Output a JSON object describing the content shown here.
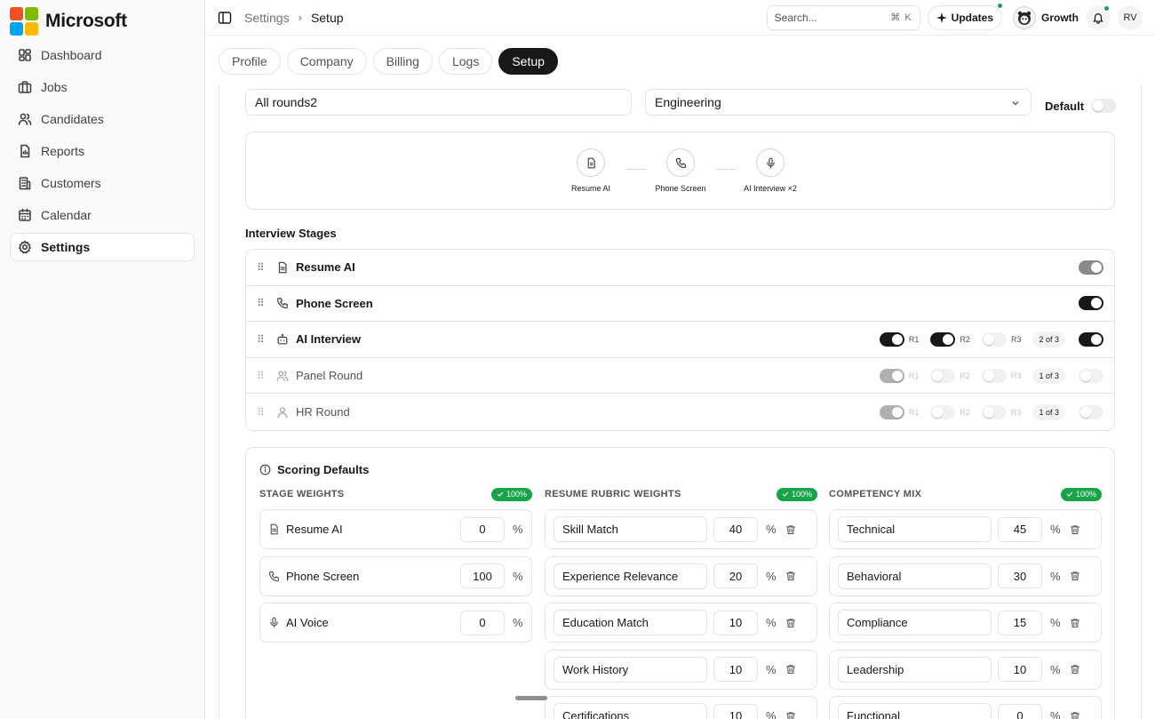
{
  "brand": {
    "name": "Microsoft",
    "colors": [
      "#f25022",
      "#7fba00",
      "#00a4ef",
      "#ffb900"
    ]
  },
  "sidebar": {
    "items": [
      {
        "label": "Dashboard",
        "icon": "dashboard-icon"
      },
      {
        "label": "Jobs",
        "icon": "briefcase-icon"
      },
      {
        "label": "Candidates",
        "icon": "users-icon"
      },
      {
        "label": "Reports",
        "icon": "report-icon"
      },
      {
        "label": "Customers",
        "icon": "building-icon"
      },
      {
        "label": "Calendar",
        "icon": "calendar-icon"
      },
      {
        "label": "Settings",
        "icon": "gear-icon",
        "active": true
      }
    ]
  },
  "header": {
    "breadcrumb": [
      "Settings",
      "Setup"
    ],
    "search_placeholder": "Search...",
    "search_shortcut": "⌘ K",
    "updates_label": "Updates",
    "plan_label": "Growth",
    "user_initials": "RV",
    "status_color": "#16a34a"
  },
  "tabs": [
    {
      "label": "Profile"
    },
    {
      "label": "Company"
    },
    {
      "label": "Billing"
    },
    {
      "label": "Logs"
    },
    {
      "label": "Setup",
      "active": true
    }
  ],
  "pipeline": {
    "name_value": "All rounds2",
    "department_value": "Engineering",
    "default_label": "Default",
    "default_on": false,
    "flow": [
      {
        "label": "Resume AI",
        "icon": "document-icon"
      },
      {
        "label": "Phone Screen",
        "icon": "phone-icon"
      },
      {
        "label": "AI Interview ×2",
        "icon": "microphone-icon"
      }
    ]
  },
  "stages": {
    "title": "Interview Stages",
    "rows": [
      {
        "label": "Resume AI",
        "icon": "document-icon",
        "enabled": true
      },
      {
        "label": "Phone Screen",
        "icon": "phone-icon",
        "enabled": true
      },
      {
        "label": "AI Interview",
        "icon": "bot-icon",
        "enabled": true,
        "rounds": [
          "R1",
          "R2",
          "R3"
        ],
        "rounds_on": [
          true,
          true,
          false
        ],
        "count": "2 of 3"
      },
      {
        "label": "Panel Round",
        "icon": "users-icon",
        "enabled": false,
        "rounds": [
          "R1",
          "R2",
          "R3"
        ],
        "rounds_on": [
          true,
          false,
          false
        ],
        "count": "1 of 3"
      },
      {
        "label": "HR Round",
        "icon": "user-icon",
        "enabled": false,
        "rounds": [
          "R1",
          "R2",
          "R3"
        ],
        "rounds_on": [
          true,
          false,
          false
        ],
        "count": "1 of 3"
      }
    ]
  },
  "scoring": {
    "title": "Scoring Defaults",
    "percent_sign": "%",
    "stage_weights": {
      "header": "STAGE WEIGHTS",
      "total": "100%",
      "rows": [
        {
          "label": "Resume AI",
          "icon": "document-icon",
          "value": "0"
        },
        {
          "label": "Phone Screen",
          "icon": "phone-icon",
          "value": "100"
        },
        {
          "label": "AI Voice",
          "icon": "microphone-icon",
          "value": "0"
        }
      ]
    },
    "rubric_weights": {
      "header": "RESUME RUBRIC WEIGHTS",
      "total": "100%",
      "rows": [
        {
          "label": "Skill Match",
          "value": "40"
        },
        {
          "label": "Experience Relevance",
          "value": "20"
        },
        {
          "label": "Education Match",
          "value": "10"
        },
        {
          "label": "Work History",
          "value": "10"
        },
        {
          "label": "Certifications",
          "value": "10"
        }
      ]
    },
    "competency_mix": {
      "header": "COMPETENCY MIX",
      "total": "100%",
      "rows": [
        {
          "label": "Technical",
          "value": "45"
        },
        {
          "label": "Behavioral",
          "value": "30"
        },
        {
          "label": "Compliance",
          "value": "15"
        },
        {
          "label": "Leadership",
          "value": "10"
        },
        {
          "label": "Functional",
          "value": "0"
        }
      ]
    }
  }
}
